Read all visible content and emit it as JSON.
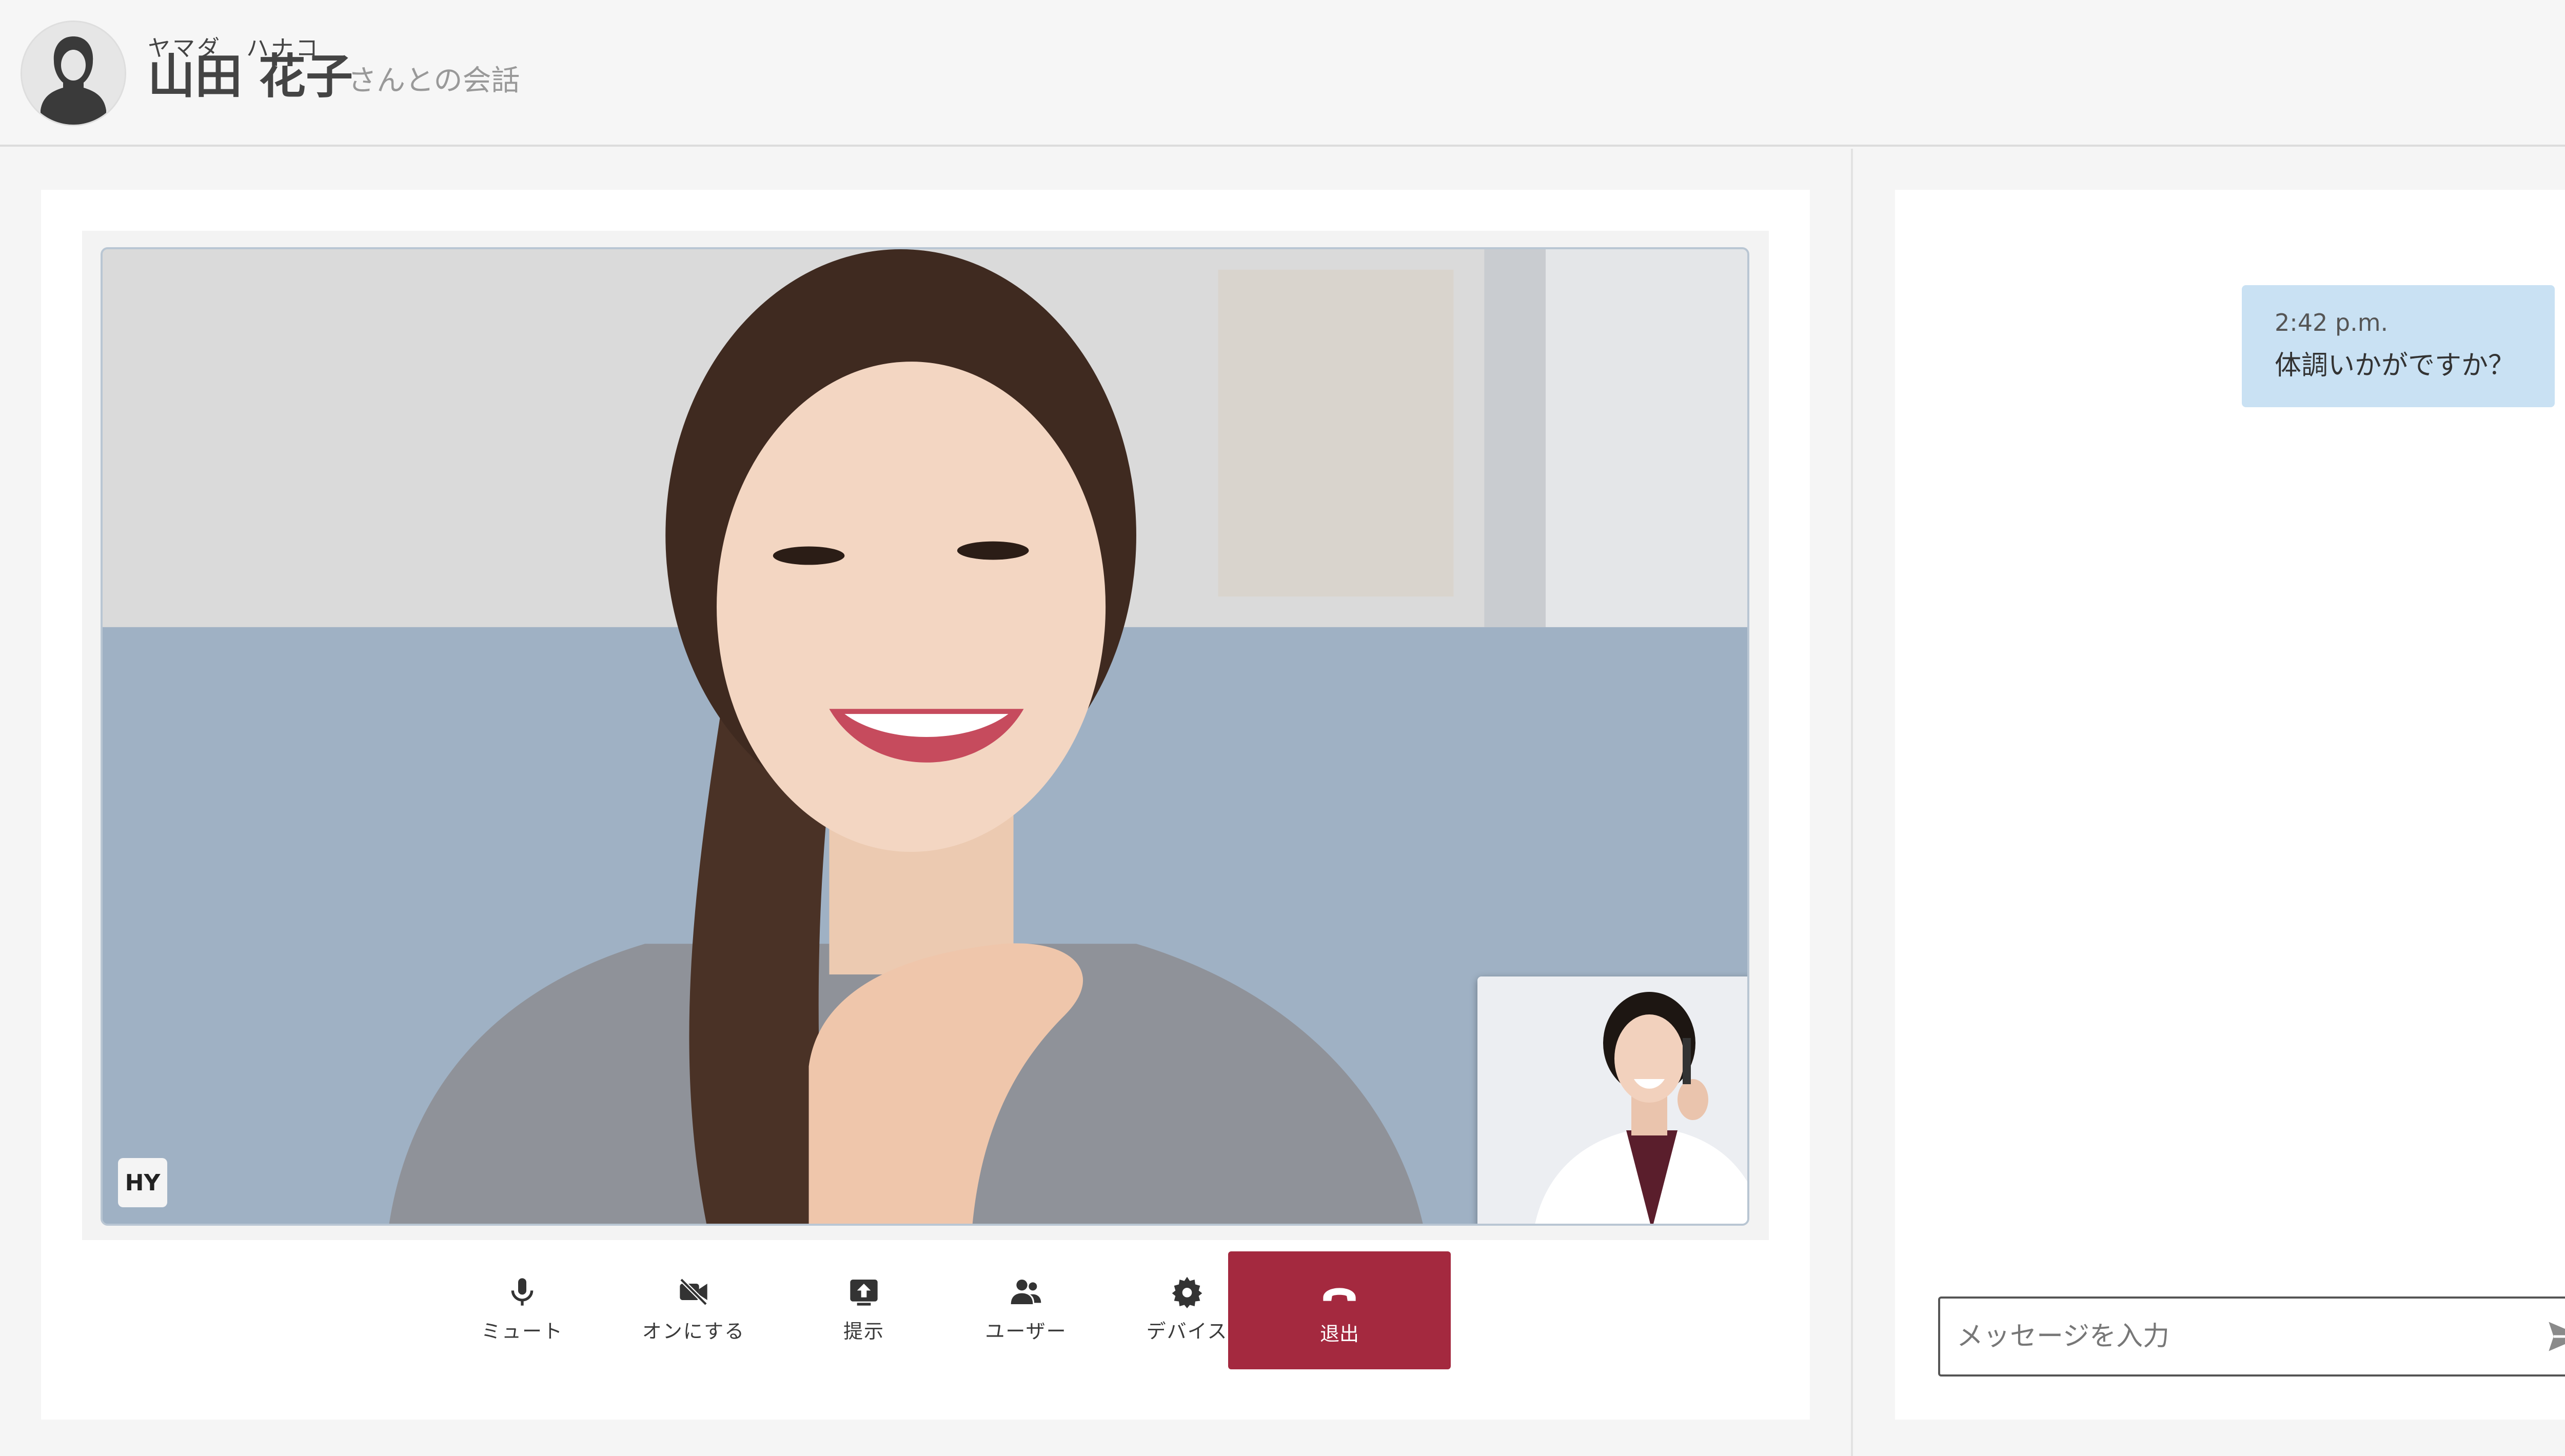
{
  "header": {
    "furigana": "ヤマダ　ハナコ",
    "name": "山田 花子",
    "name_suffix": "さんとの会話"
  },
  "video": {
    "participant_initials": "HY",
    "remote_participant": "main-video",
    "self_view": "self-view"
  },
  "controls": {
    "mute_label": "ミュート",
    "camera_label": "オンにする",
    "present_label": "提示",
    "users_label": "ユーザー",
    "devices_label": "デバイス",
    "leave_label": "退出"
  },
  "chat": {
    "messages": [
      {
        "time": "2:42 p.m.",
        "text": "体調いかがですか？",
        "status": "seen"
      }
    ],
    "input_placeholder": "メッセージを入力"
  },
  "colors": {
    "leave_button": "#a4293f",
    "message_bubble": "#c9e1f3",
    "seen_icon": "#2a6fb5"
  },
  "icons": {
    "mute": "microphone-icon",
    "camera": "video-off-icon",
    "present": "upload-icon",
    "users": "users-icon",
    "devices": "gear-icon",
    "leave": "phone-hangup-icon",
    "send": "send-icon",
    "seen": "eye-icon"
  }
}
